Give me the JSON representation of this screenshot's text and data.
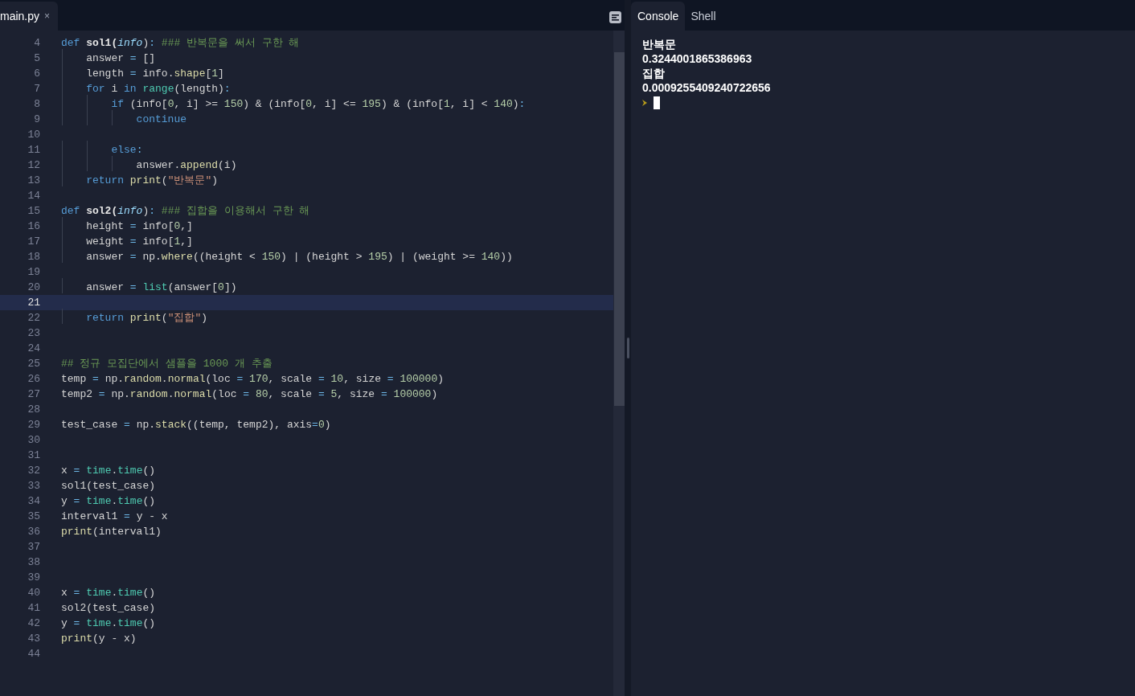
{
  "editor": {
    "tab": {
      "label": "main.py",
      "close": "×",
      "selected": true
    },
    "lines": [
      {
        "number": "4",
        "selected": false,
        "tokens": [
          {
            "kind": "kw",
            "text": "def"
          },
          {
            "kind": "name",
            "text": " sol1("
          },
          {
            "kind": "param",
            "text": "info"
          },
          {
            "kind": "plain",
            "text": ")"
          },
          {
            "kind": "op",
            "text": ":"
          },
          {
            "kind": "cmt",
            "text": " ### 반복문을 써서 구한 해"
          }
        ]
      },
      {
        "number": "5",
        "selected": false,
        "tokens": [
          {
            "kind": "plain",
            "text": "    answer "
          },
          {
            "kind": "op",
            "text": "="
          },
          {
            "kind": "plain",
            "text": " []"
          }
        ]
      },
      {
        "number": "6",
        "selected": false,
        "tokens": [
          {
            "kind": "plain",
            "text": "    length "
          },
          {
            "kind": "op",
            "text": "="
          },
          {
            "kind": "plain",
            "text": " info."
          },
          {
            "kind": "fn",
            "text": "shape"
          },
          {
            "kind": "plain",
            "text": "["
          },
          {
            "kind": "num",
            "text": "1"
          },
          {
            "kind": "plain",
            "text": "]"
          }
        ]
      },
      {
        "number": "7",
        "selected": false,
        "tokens": [
          {
            "kind": "kw",
            "text": "    for"
          },
          {
            "kind": "plain",
            "text": " i "
          },
          {
            "kind": "kw",
            "text": "in"
          },
          {
            "kind": "builtin",
            "text": " range"
          },
          {
            "kind": "plain",
            "text": "(length)"
          },
          {
            "kind": "op",
            "text": ":"
          }
        ]
      },
      {
        "number": "8",
        "selected": false,
        "tokens": [
          {
            "kind": "kw",
            "text": "        if"
          },
          {
            "kind": "plain",
            "text": " (info["
          },
          {
            "kind": "num",
            "text": "0"
          },
          {
            "kind": "plain",
            "text": ", i] >= "
          },
          {
            "kind": "num",
            "text": "150"
          },
          {
            "kind": "plain",
            "text": ") & (info["
          },
          {
            "kind": "num",
            "text": "0"
          },
          {
            "kind": "plain",
            "text": ", i] <= "
          },
          {
            "kind": "num",
            "text": "195"
          },
          {
            "kind": "plain",
            "text": ") & (info["
          },
          {
            "kind": "num",
            "text": "1"
          },
          {
            "kind": "plain",
            "text": ", i] < "
          },
          {
            "kind": "num",
            "text": "140"
          },
          {
            "kind": "plain",
            "text": ")"
          },
          {
            "kind": "op",
            "text": ":"
          }
        ]
      },
      {
        "number": "9",
        "selected": false,
        "tokens": [
          {
            "kind": "kw",
            "text": "            continue"
          }
        ]
      },
      {
        "number": "10",
        "selected": false
      },
      {
        "number": "11",
        "selected": false,
        "tokens": [
          {
            "kind": "kw",
            "text": "        else"
          },
          {
            "kind": "op",
            "text": ":"
          }
        ]
      },
      {
        "number": "12",
        "selected": false,
        "tokens": [
          {
            "kind": "plain",
            "text": "            answer."
          },
          {
            "kind": "fn",
            "text": "append"
          },
          {
            "kind": "plain",
            "text": "(i)"
          }
        ]
      },
      {
        "number": "13",
        "selected": false,
        "tokens": [
          {
            "kind": "kw",
            "text": "    return"
          },
          {
            "kind": "fn",
            "text": " print"
          },
          {
            "kind": "plain",
            "text": "("
          },
          {
            "kind": "str",
            "text": "\"반복문\""
          },
          {
            "kind": "plain",
            "text": ")"
          }
        ]
      },
      {
        "number": "14",
        "selected": false
      },
      {
        "number": "15",
        "selected": false,
        "tokens": [
          {
            "kind": "kw",
            "text": "def"
          },
          {
            "kind": "name",
            "text": " sol2("
          },
          {
            "kind": "param",
            "text": "info"
          },
          {
            "kind": "plain",
            "text": ")"
          },
          {
            "kind": "op",
            "text": ":"
          },
          {
            "kind": "cmt",
            "text": " ### 집합을 이용해서 구한 해"
          }
        ]
      },
      {
        "number": "16",
        "selected": false,
        "tokens": [
          {
            "kind": "plain",
            "text": "    height "
          },
          {
            "kind": "op",
            "text": "="
          },
          {
            "kind": "plain",
            "text": " info["
          },
          {
            "kind": "num",
            "text": "0"
          },
          {
            "kind": "plain",
            "text": ",]"
          }
        ]
      },
      {
        "number": "17",
        "selected": false,
        "tokens": [
          {
            "kind": "plain",
            "text": "    weight "
          },
          {
            "kind": "op",
            "text": "="
          },
          {
            "kind": "plain",
            "text": " info["
          },
          {
            "kind": "num",
            "text": "1"
          },
          {
            "kind": "plain",
            "text": ",]"
          }
        ]
      },
      {
        "number": "18",
        "selected": false,
        "tokens": [
          {
            "kind": "plain",
            "text": "    answer "
          },
          {
            "kind": "op",
            "text": "="
          },
          {
            "kind": "plain",
            "text": " np."
          },
          {
            "kind": "fn",
            "text": "where"
          },
          {
            "kind": "plain",
            "text": "((height < "
          },
          {
            "kind": "num",
            "text": "150"
          },
          {
            "kind": "plain",
            "text": ") | (height > "
          },
          {
            "kind": "num",
            "text": "195"
          },
          {
            "kind": "plain",
            "text": ") | (weight >= "
          },
          {
            "kind": "num",
            "text": "140"
          },
          {
            "kind": "plain",
            "text": "))"
          }
        ]
      },
      {
        "number": "19",
        "selected": false
      },
      {
        "number": "20",
        "selected": false,
        "tokens": [
          {
            "kind": "plain",
            "text": "    answer "
          },
          {
            "kind": "op",
            "text": "="
          },
          {
            "kind": "builtin",
            "text": " list"
          },
          {
            "kind": "plain",
            "text": "(answer["
          },
          {
            "kind": "num",
            "text": "0"
          },
          {
            "kind": "plain",
            "text": "])"
          }
        ]
      },
      {
        "number": "21",
        "selected": true
      },
      {
        "number": "22",
        "selected": false,
        "tokens": [
          {
            "kind": "kw",
            "text": "    return"
          },
          {
            "kind": "fn",
            "text": " print"
          },
          {
            "kind": "plain",
            "text": "("
          },
          {
            "kind": "str",
            "text": "\"집합\""
          },
          {
            "kind": "plain",
            "text": ")"
          }
        ]
      },
      {
        "number": "23",
        "selected": false
      },
      {
        "number": "24",
        "selected": false
      },
      {
        "number": "25",
        "selected": false,
        "tokens": [
          {
            "kind": "cmt",
            "text": "## 정규 모집단에서 샘플을 1000 개 추출"
          }
        ]
      },
      {
        "number": "26",
        "selected": false,
        "tokens": [
          {
            "kind": "plain",
            "text": "temp "
          },
          {
            "kind": "op",
            "text": "="
          },
          {
            "kind": "plain",
            "text": " np."
          },
          {
            "kind": "fn",
            "text": "random"
          },
          {
            "kind": "plain",
            "text": "."
          },
          {
            "kind": "fn",
            "text": "normal"
          },
          {
            "kind": "plain",
            "text": "(loc "
          },
          {
            "kind": "op",
            "text": "="
          },
          {
            "kind": "num",
            "text": " 170"
          },
          {
            "kind": "plain",
            "text": ", scale "
          },
          {
            "kind": "op",
            "text": "="
          },
          {
            "kind": "num",
            "text": " 10"
          },
          {
            "kind": "plain",
            "text": ", size "
          },
          {
            "kind": "op",
            "text": "="
          },
          {
            "kind": "num",
            "text": " 100000"
          },
          {
            "kind": "plain",
            "text": ")"
          }
        ]
      },
      {
        "number": "27",
        "selected": false,
        "tokens": [
          {
            "kind": "plain",
            "text": "temp2 "
          },
          {
            "kind": "op",
            "text": "="
          },
          {
            "kind": "plain",
            "text": " np."
          },
          {
            "kind": "fn",
            "text": "random"
          },
          {
            "kind": "plain",
            "text": "."
          },
          {
            "kind": "fn",
            "text": "normal"
          },
          {
            "kind": "plain",
            "text": "(loc "
          },
          {
            "kind": "op",
            "text": "="
          },
          {
            "kind": "num",
            "text": " 80"
          },
          {
            "kind": "plain",
            "text": ", scale "
          },
          {
            "kind": "op",
            "text": "="
          },
          {
            "kind": "num",
            "text": " 5"
          },
          {
            "kind": "plain",
            "text": ", size "
          },
          {
            "kind": "op",
            "text": "="
          },
          {
            "kind": "num",
            "text": " 100000"
          },
          {
            "kind": "plain",
            "text": ")"
          }
        ]
      },
      {
        "number": "28",
        "selected": false
      },
      {
        "number": "29",
        "selected": false,
        "tokens": [
          {
            "kind": "plain",
            "text": "test_case "
          },
          {
            "kind": "op",
            "text": "="
          },
          {
            "kind": "plain",
            "text": " np."
          },
          {
            "kind": "fn",
            "text": "stack"
          },
          {
            "kind": "plain",
            "text": "((temp, temp2), axis"
          },
          {
            "kind": "op",
            "text": "="
          },
          {
            "kind": "num",
            "text": "0"
          },
          {
            "kind": "plain",
            "text": ")"
          }
        ]
      },
      {
        "number": "30",
        "selected": false
      },
      {
        "number": "31",
        "selected": false
      },
      {
        "number": "32",
        "selected": false,
        "tokens": [
          {
            "kind": "plain",
            "text": "x "
          },
          {
            "kind": "op",
            "text": "="
          },
          {
            "kind": "builtin",
            "text": " time"
          },
          {
            "kind": "plain",
            "text": "."
          },
          {
            "kind": "builtin",
            "text": "time"
          },
          {
            "kind": "plain",
            "text": "()"
          }
        ]
      },
      {
        "number": "33",
        "selected": false,
        "tokens": [
          {
            "kind": "plain",
            "text": "sol1(test_case)"
          }
        ]
      },
      {
        "number": "34",
        "selected": false,
        "tokens": [
          {
            "kind": "plain",
            "text": "y "
          },
          {
            "kind": "op",
            "text": "="
          },
          {
            "kind": "builtin",
            "text": " time"
          },
          {
            "kind": "plain",
            "text": "."
          },
          {
            "kind": "builtin",
            "text": "time"
          },
          {
            "kind": "plain",
            "text": "()"
          }
        ]
      },
      {
        "number": "35",
        "selected": false,
        "tokens": [
          {
            "kind": "plain",
            "text": "interval1 "
          },
          {
            "kind": "op",
            "text": "="
          },
          {
            "kind": "plain",
            "text": " y - x"
          }
        ]
      },
      {
        "number": "36",
        "selected": false,
        "tokens": [
          {
            "kind": "fn",
            "text": "print"
          },
          {
            "kind": "plain",
            "text": "(interval1)"
          }
        ]
      },
      {
        "number": "37",
        "selected": false
      },
      {
        "number": "38",
        "selected": false
      },
      {
        "number": "39",
        "selected": false
      },
      {
        "number": "40",
        "selected": false,
        "tokens": [
          {
            "kind": "plain",
            "text": "x "
          },
          {
            "kind": "op",
            "text": "="
          },
          {
            "kind": "builtin",
            "text": " time"
          },
          {
            "kind": "plain",
            "text": "."
          },
          {
            "kind": "builtin",
            "text": "time"
          },
          {
            "kind": "plain",
            "text": "()"
          }
        ]
      },
      {
        "number": "41",
        "selected": false,
        "tokens": [
          {
            "kind": "plain",
            "text": "sol2(test_case)"
          }
        ]
      },
      {
        "number": "42",
        "selected": false,
        "tokens": [
          {
            "kind": "plain",
            "text": "y "
          },
          {
            "kind": "op",
            "text": "="
          },
          {
            "kind": "builtin",
            "text": " time"
          },
          {
            "kind": "plain",
            "text": "."
          },
          {
            "kind": "builtin",
            "text": "time"
          },
          {
            "kind": "plain",
            "text": "()"
          }
        ]
      },
      {
        "number": "43",
        "selected": false,
        "tokens": [
          {
            "kind": "fn",
            "text": "print"
          },
          {
            "kind": "plain",
            "text": "(y - x)"
          }
        ]
      },
      {
        "number": "44",
        "selected": false
      }
    ]
  },
  "console": {
    "tabs": [
      {
        "label": "Console",
        "selected": true
      },
      {
        "label": "Shell",
        "selected": false
      }
    ],
    "output": [
      "반복문",
      "0.3244001865386963",
      "집합",
      "0.0009255409240722656"
    ]
  }
}
